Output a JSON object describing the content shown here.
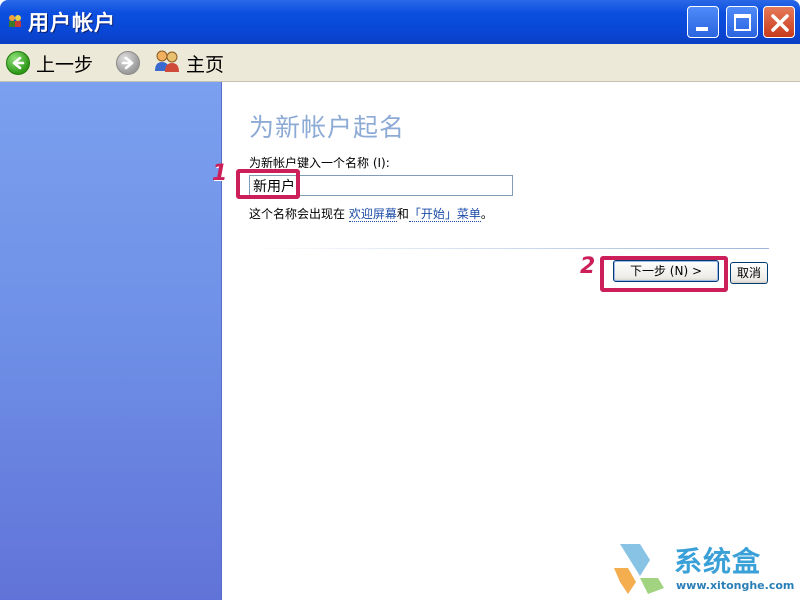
{
  "window": {
    "title": "用户帐户",
    "icon": "users-icon"
  },
  "toolbar": {
    "back_label": "上一步",
    "home_label": "主页"
  },
  "main": {
    "page_title": "为新帐户起名",
    "field_label": "为新帐户键入一个名称 (I):",
    "name_value": "新用户",
    "hint_prefix": "这个名称会出现在 ",
    "hint_link_welcome": "欢迎屏幕",
    "hint_and": "和",
    "hint_link_start": "「开始」菜单",
    "hint_suffix": "。",
    "next_label": "下一步 (N) >",
    "cancel_label": "取消"
  },
  "annotations": {
    "marker_1": "1",
    "marker_2": "2",
    "color": "#cc1f5a"
  },
  "watermark": {
    "brand": "系统盒",
    "url": "www.xitonghe.com"
  },
  "colors": {
    "titlebar": "#0a47d6",
    "side_panel": "#7ba0ef",
    "page_title": "#8eabd6"
  }
}
